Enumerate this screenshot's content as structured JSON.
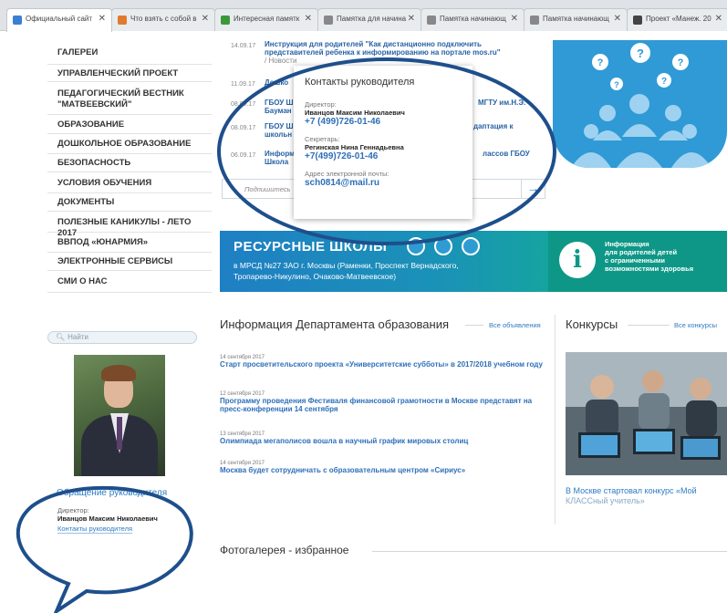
{
  "browser": {
    "tabs": [
      {
        "label": "Официальный сайт",
        "favicon_color": "#3b7fd4",
        "active": true
      },
      {
        "label": "Что взять с собой в",
        "favicon_color": "#e07a2e",
        "active": false
      },
      {
        "label": "Интересная памятк",
        "favicon_color": "#3a9a3a",
        "active": false
      },
      {
        "label": "Памятка для начина",
        "favicon_color": "#888888",
        "active": false
      },
      {
        "label": "Памятка начинающ",
        "favicon_color": "#888888",
        "active": false
      },
      {
        "label": "Памятка начинающ",
        "favicon_color": "#888888",
        "active": false
      },
      {
        "label": "Проект «Манеж. 20",
        "favicon_color": "#444444",
        "active": false
      }
    ],
    "close_glyph": "✕"
  },
  "sidebar": {
    "items": [
      {
        "label": "ГАЛЕРЕИ"
      },
      {
        "label": "УПРАВЛЕНЧЕСКИЙ ПРОЕКТ"
      },
      {
        "label": "ПЕДАГОГИЧЕСКИЙ ВЕСТНИК \"МАТВЕЕВСКИЙ\""
      },
      {
        "label": "ОБРАЗОВАНИЕ"
      },
      {
        "label": "ДОШКОЛЬНОЕ ОБРАЗОВАНИЕ"
      },
      {
        "label": "БЕЗОПАСНОСТЬ"
      },
      {
        "label": "УСЛОВИЯ ОБУЧЕНИЯ"
      },
      {
        "label": "ДОКУМЕНТЫ"
      },
      {
        "label": "ПОЛЕЗНЫЕ КАНИКУЛЫ - ЛЕТО 2017"
      },
      {
        "label": "ВВПОД «ЮНАРМИЯ»"
      },
      {
        "label": "ЭЛЕКТРОННЫЕ СЕРВИСЫ"
      },
      {
        "label": "СМИ О НАС"
      }
    ],
    "search_placeholder": "Найти",
    "appeal_title": "Обращение руководителя",
    "director_label": "Директор:",
    "director_name": "Иванцов Максим Николаевич",
    "contacts_link": "Контакты руководителя"
  },
  "news_top": [
    {
      "date": "14.09.17",
      "title": "Инструкция для родителей \"Как дистанционно подключить представителей ребенка к информированию на портале mos.ru\"",
      "source": "/ Новости"
    },
    {
      "date": "11.09.17",
      "title": "Дошко",
      "title_tail": "ки",
      "source": ""
    },
    {
      "date": "08.09.17",
      "title": "ГБОУ Ш Бауман",
      "title_tail": "МГТУ им.Н.Э.",
      "source": ""
    },
    {
      "date": "08.09.17",
      "title": "ГБОУ Ш школьн",
      "title_tail": "даптация к",
      "source": ""
    },
    {
      "date": "06.09.17",
      "title": "Информ Школа",
      "title_tail": "лассов ГБОУ",
      "source": ""
    }
  ],
  "subscribe_placeholder": "Подпишитесь",
  "subscribe_arrow": "→",
  "popup": {
    "title": "Контакты руководителя",
    "director_label": "Директор:",
    "director_name": "Иванцов Максим Николаевич",
    "director_phone": "+7 (499)726-01-46",
    "secretary_label": "Секретарь:",
    "secretary_name": "Регинская Нина Геннадьевна",
    "secretary_phone": "+7(499)726-01-46",
    "email_label": "Адрес электронной почты:",
    "email": "sch0814@mail.ru"
  },
  "resource_banner": {
    "title": "РЕСУРСНЫЕ ШКОЛЫ",
    "subtitle_line1": "в МРСД №27 ЗАО г. Москвы (Раменки, Проспект Вернадского,",
    "subtitle_line2": "Тропарево-Никулино, Очаково-Матвеевское)",
    "info_icon": "i",
    "info_text_line1": "Информация",
    "info_text_line2": "для родителей детей",
    "info_text_line3": "с ограниченными",
    "info_text_line4": "возможностями здоровья"
  },
  "department": {
    "title": "Информация Департамента образования",
    "all_link": "Все объявления",
    "articles": [
      {
        "date": "14 сентября 2017",
        "title": "Старт просветительского проекта «Университетские субботы» в 2017/2018 учебном году"
      },
      {
        "date": "12 сентября 2017",
        "title": "Программу проведения Фестиваля финансовой грамотности в Москве представят на пресс-конференции 14 сентября"
      },
      {
        "date": "13 сентября 2017",
        "title": "Олимпиада мегаполисов вошла в научный график мировых столиц"
      },
      {
        "date": "14 сентября 2017",
        "title": "Москва будет сотрудничать с образовательным центром «Сириус»"
      }
    ]
  },
  "contests": {
    "title": "Конкурсы",
    "all_link": "Все конкурсы",
    "caption_main": "В Москве стартовал конкурс «Мой",
    "caption_rest": "КЛАССный учитель»"
  },
  "gallery": {
    "title": "Фотогалерея - избранное"
  },
  "colors": {
    "link": "#2e7bc4",
    "annotation": "#1e4f8c",
    "banner_teal": "#0f9a86",
    "banner_blue": "#1f7fc4"
  }
}
